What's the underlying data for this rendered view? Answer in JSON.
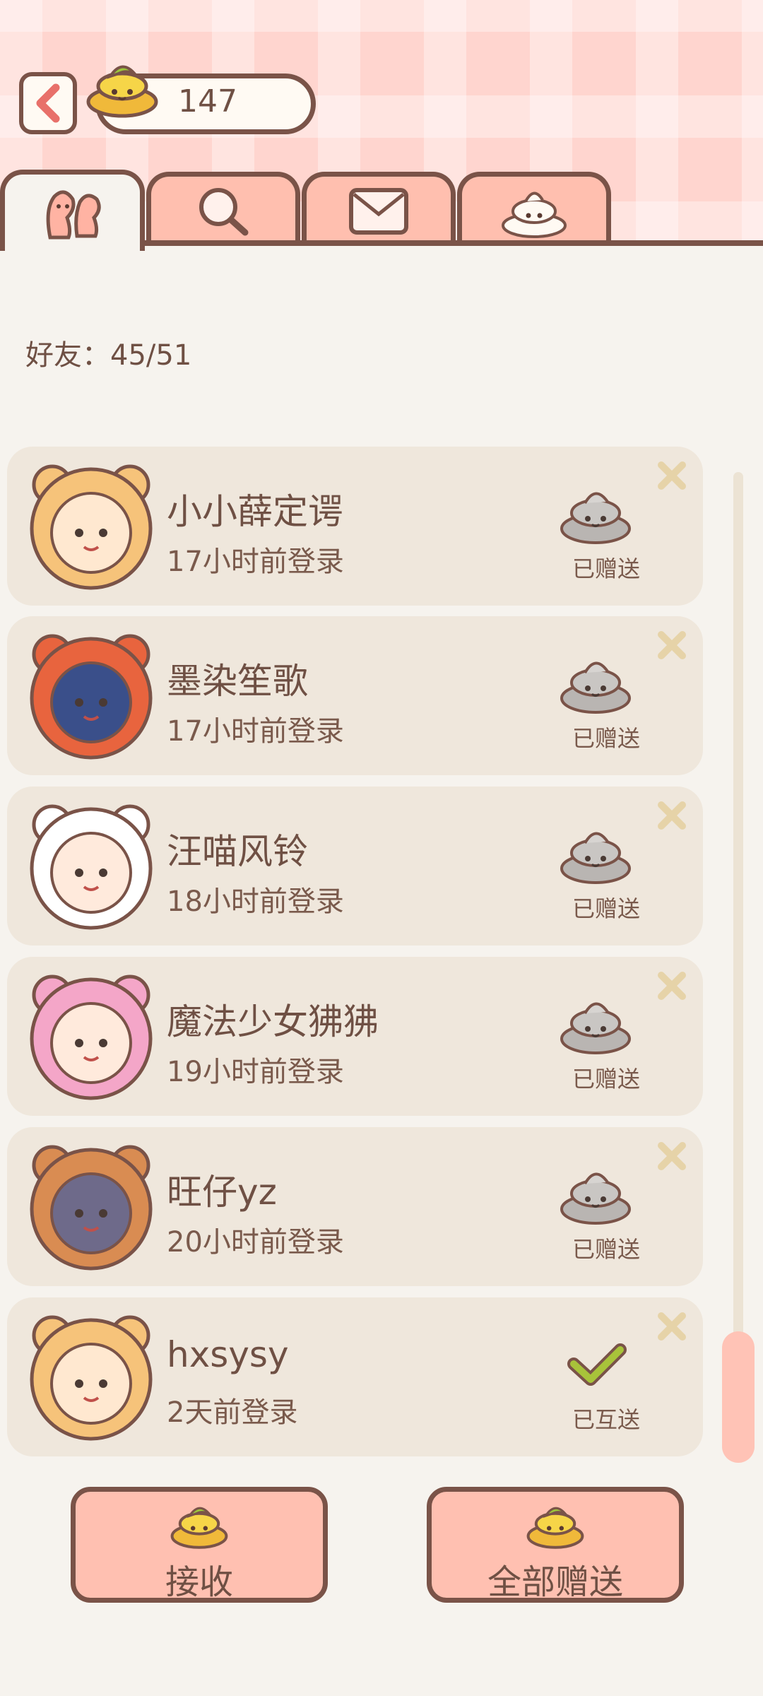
{
  "header": {
    "currency_amount": "147"
  },
  "tabs": [
    {
      "icon": "friends-icon",
      "active": true
    },
    {
      "icon": "search-icon",
      "active": false
    },
    {
      "icon": "mail-icon",
      "active": false
    },
    {
      "icon": "poop-icon",
      "active": false
    }
  ],
  "friends_count_label": "好友：45/51",
  "friends": [
    {
      "name": "小小薛定谔",
      "login": "17小时前登录",
      "status": "已赠送",
      "avatar": "bear-avatar"
    },
    {
      "name": "墨染笙歌",
      "login": "17小时前登录",
      "status": "已赠送",
      "avatar": "red-panda-avatar"
    },
    {
      "name": "汪喵风铃",
      "login": "18小时前登录",
      "status": "已赠送",
      "avatar": "cat-avatar"
    },
    {
      "name": "魔法少女狒狒",
      "login": "19小时前登录",
      "status": "已赠送",
      "avatar": "peach-avatar"
    },
    {
      "name": "旺仔yz",
      "login": "20小时前登录",
      "status": "已赠送",
      "avatar": "raccoon-avatar"
    },
    {
      "name": "hxsysy",
      "login": "2天前登录",
      "status": "已互送",
      "avatar": "bear-avatar"
    }
  ],
  "buttons": {
    "receive": "接收",
    "send_all": "全部赠送"
  },
  "colors": {
    "accent": "#ffc0b1",
    "outline": "#7a5348",
    "card": "#efe7dc",
    "check": "#a8c33a"
  }
}
